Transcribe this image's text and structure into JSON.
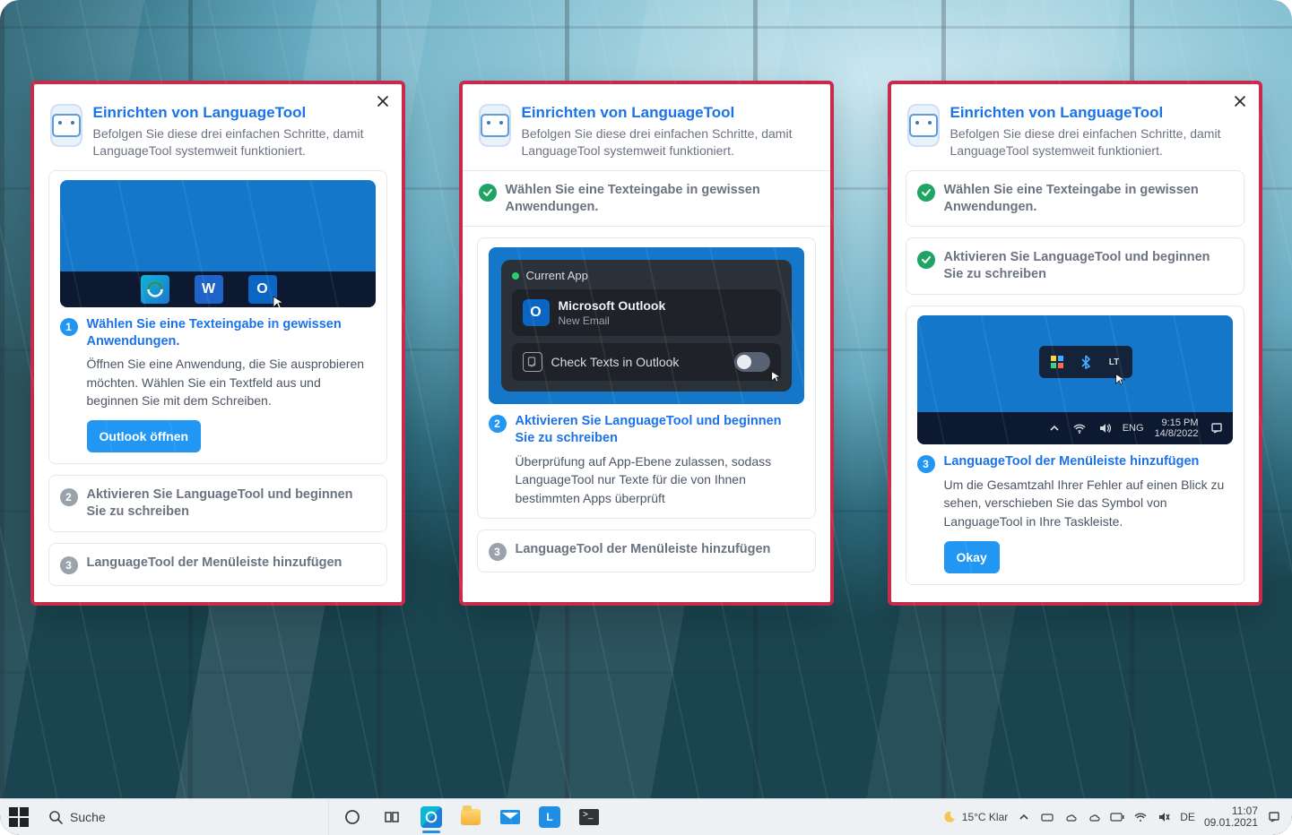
{
  "header": {
    "title": "Einrichten von LanguageTool",
    "subtitle": "Befolgen Sie diese drei einfachen Schritte, damit LanguageTool systemweit funktioniert."
  },
  "steps": {
    "s1": {
      "num": "1",
      "title": "Wählen Sie eine Texteingabe in gewissen Anwendungen.",
      "body": "Öffnen Sie eine Anwendung, die Sie ausprobieren möchten. Wählen Sie ein Textfeld aus und beginnen Sie mit dem Schreiben.",
      "done_title": "Wählen Sie eine Texteingabe in gewissen Anwendungen.",
      "cta": "Outlook öffnen"
    },
    "s2": {
      "num": "2",
      "title": "Aktivieren Sie LanguageTool und beginnen Sie zu schreiben",
      "body": "Überprüfung auf App-Ebene zulassen, sodass LanguageTool nur Texte für die von Ihnen bestimmten Apps überprüft",
      "inactive_title": "Aktivieren Sie LanguageTool und beginnen Sie zu schreiben"
    },
    "s3": {
      "num": "3",
      "title": "LanguageTool der Menüleiste hinzufügen",
      "body": "Um die Gesamtzahl Ihrer Fehler auf einen Blick zu sehen, verschieben Sie das Symbol von LanguageTool in Ihre Taskleiste.",
      "cta": "Okay"
    }
  },
  "illu2": {
    "hdr": "Current App",
    "app_name": "Microsoft Outlook",
    "app_sub": "New Email",
    "check_label": "Check Texts in Outlook"
  },
  "illu3": {
    "lang": "ENG",
    "time": "9:15 PM",
    "date": "14/8/2022",
    "lt": "LT"
  },
  "taskbar": {
    "search_placeholder": "Suche",
    "weather_text": "15°C  Klar",
    "lang": "DE",
    "time": "11:07",
    "date": "09.01.2021"
  }
}
